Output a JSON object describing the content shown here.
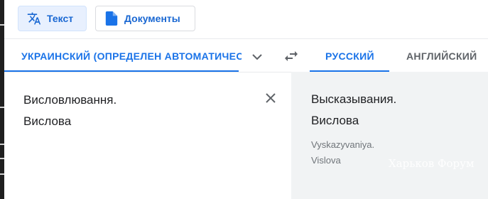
{
  "toolbar": {
    "text_mode_label": "Текст",
    "documents_mode_label": "Документы"
  },
  "languages": {
    "source_label": "УКРАИНСКИЙ (ОПРЕДЕЛЕН АВТОМАТИЧЕСКИ)",
    "target_tabs": [
      "РУССКИЙ",
      "АНГЛИЙСКИЙ"
    ]
  },
  "source": {
    "lines": [
      "Висловлювання.",
      "Вислова"
    ]
  },
  "translation": {
    "lines": [
      "Высказывания.",
      "Вислова"
    ],
    "transliteration": [
      "Vyskazyvaniya.",
      "Vislova"
    ]
  },
  "watermark": "Харьков Форум",
  "colors": {
    "accent": "#1a73e8",
    "selected_button_bg": "#e8f0fe",
    "output_panel_bg": "#f1f3f4"
  },
  "icons": {
    "text_mode": "translate-icon",
    "documents_mode": "document-icon",
    "more_languages": "chevron-down-icon",
    "swap": "swap-languages-icon",
    "clear": "close-icon"
  }
}
